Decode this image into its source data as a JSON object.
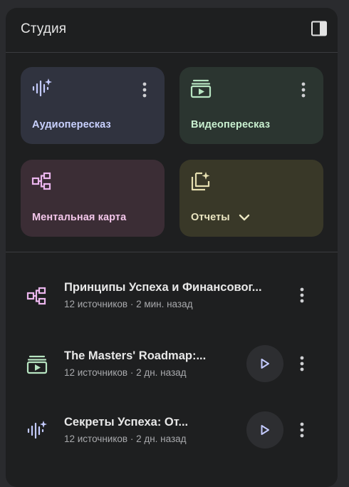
{
  "header": {
    "title": "Студия",
    "toggle_icon": "side-panel-icon"
  },
  "tiles": [
    {
      "label": "Аудиопересказ",
      "icon": "audio-sparkle-icon",
      "bg": "#30333f",
      "fg": "#c9d1ff",
      "accent": "#c4cbff"
    },
    {
      "label": "Видеопересказ",
      "icon": "video-icon",
      "bg": "#2b3530",
      "fg": "#c9f0d0",
      "accent": "#b7e4c1"
    },
    {
      "label": "Ментальная карта",
      "icon": "mind-map-icon",
      "bg": "#3b2d35",
      "fg": "#f3c6ea",
      "accent": "#ecb6ee"
    },
    {
      "label": "Отчеты",
      "icon": "reports-icon",
      "bg": "#393828",
      "fg": "#ebe6c2",
      "accent": "#e6dfb0"
    }
  ],
  "items": [
    {
      "title": "Принципы Успеха и Финансовог...",
      "subtitle": "12 источников · 2 мин. назад",
      "icon": "mind-map-icon",
      "color": "#ecb6ee",
      "has_play": false
    },
    {
      "title": "The Masters' Roadmap:...",
      "subtitle": "12 источников · 2 дн. назад",
      "icon": "video-icon",
      "color": "#b7e4c1",
      "has_play": true
    },
    {
      "title": "Секреты Успеха: От...",
      "subtitle": "12 источников · 2 дн. назад",
      "icon": "audio-sparkle-icon",
      "color": "#c4cbff",
      "has_play": true
    }
  ],
  "colors": {
    "panel_bg": "#1e1f20",
    "page_bg": "#2a2b2e",
    "play_bg": "#2d2e31"
  }
}
